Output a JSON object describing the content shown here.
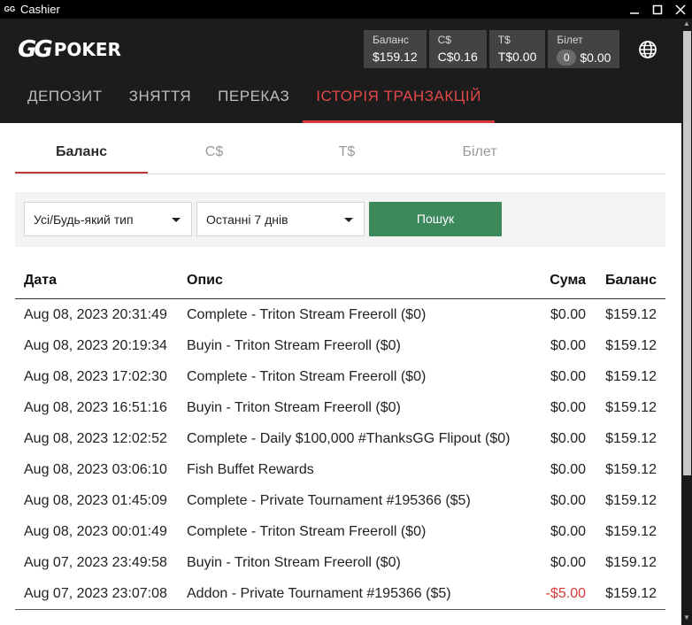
{
  "window": {
    "title": "Cashier",
    "app_icon": "GG"
  },
  "brand": {
    "gg": "GG",
    "poker": "POKER"
  },
  "balances": [
    {
      "label": "Баланс",
      "value": "$159.12"
    },
    {
      "label": "C$",
      "value": "C$0.16"
    },
    {
      "label": "T$",
      "value": "T$0.00"
    },
    {
      "label": "Білет",
      "count": "0",
      "value": "$0.00"
    }
  ],
  "nav": [
    {
      "label": "ДЕПОЗИТ"
    },
    {
      "label": "ЗНЯТТЯ"
    },
    {
      "label": "ПЕРЕКАЗ"
    },
    {
      "label": "ІСТОРІЯ ТРАНЗАКЦІЙ",
      "active": true
    }
  ],
  "subtabs": [
    {
      "label": "Баланс",
      "active": true
    },
    {
      "label": "C$"
    },
    {
      "label": "T$"
    },
    {
      "label": "Білет"
    }
  ],
  "filters": {
    "type_value": "Усі/Будь-який тип",
    "period_value": "Останні 7 днів",
    "search_label": "Пошук"
  },
  "table": {
    "headers": {
      "date": "Дата",
      "desc": "Опис",
      "amount": "Сума",
      "balance": "Баланс"
    },
    "rows": [
      {
        "date": "Aug 08, 2023 20:31:49",
        "desc": "Complete - Triton Stream Freeroll ($0)",
        "amount": "$0.00",
        "balance": "$159.12"
      },
      {
        "date": "Aug 08, 2023 20:19:34",
        "desc": "Buyin - Triton Stream Freeroll ($0)",
        "amount": "$0.00",
        "balance": "$159.12"
      },
      {
        "date": "Aug 08, 2023 17:02:30",
        "desc": "Complete - Triton Stream Freeroll ($0)",
        "amount": "$0.00",
        "balance": "$159.12"
      },
      {
        "date": "Aug 08, 2023 16:51:16",
        "desc": "Buyin - Triton Stream Freeroll ($0)",
        "amount": "$0.00",
        "balance": "$159.12"
      },
      {
        "date": "Aug 08, 2023 12:02:52",
        "desc": "Complete - Daily $100,000 #ThanksGG Flipout ($0)",
        "amount": "$0.00",
        "balance": "$159.12"
      },
      {
        "date": "Aug 08, 2023 03:06:10",
        "desc": "Fish Buffet Rewards",
        "amount": "$0.00",
        "balance": "$159.12"
      },
      {
        "date": "Aug 08, 2023 01:45:09",
        "desc": "Complete - Private Tournament #195366 ($5)",
        "amount": "$0.00",
        "balance": "$159.12"
      },
      {
        "date": "Aug 08, 2023 00:01:49",
        "desc": "Complete - Triton Stream Freeroll ($0)",
        "amount": "$0.00",
        "balance": "$159.12"
      },
      {
        "date": "Aug 07, 2023 23:49:58",
        "desc": "Buyin - Triton Stream Freeroll ($0)",
        "amount": "$0.00",
        "balance": "$159.12"
      },
      {
        "date": "Aug 07, 2023 23:07:08",
        "desc": "Addon - Private Tournament #195366 ($5)",
        "amount": "-$5.00",
        "balance": "$159.12",
        "negative": true
      }
    ]
  },
  "icons": {
    "globe": "globe-icon",
    "minimize": "minimize-icon",
    "maximize": "maximize-icon",
    "close": "close-icon"
  },
  "colors": {
    "accent_red": "#d83a3c",
    "search_green": "#3c8a5c",
    "negative": "#d63a3a"
  }
}
